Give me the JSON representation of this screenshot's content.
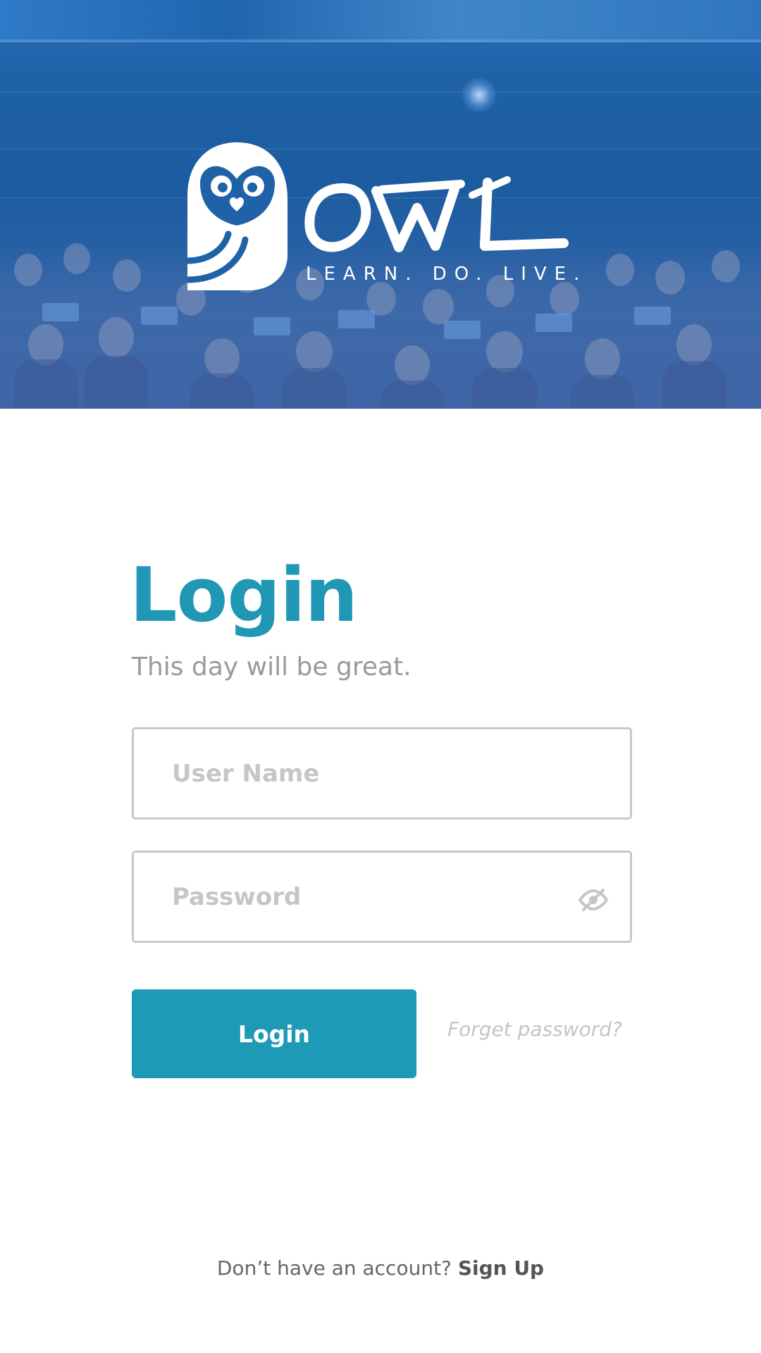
{
  "brand": {
    "name": "OWL",
    "tagline": "LEARN. DO. LIVE."
  },
  "login": {
    "title": "Login",
    "subtitle": "This day will be great.",
    "username_placeholder": "User Name",
    "username_value": "",
    "password_placeholder": "Password",
    "password_value": "",
    "password_toggle_icon": "eye-slash-icon",
    "submit_label": "Login",
    "forgot_label": "Forget password?"
  },
  "footer": {
    "prompt": "Don’t have an account?",
    "signup_label": "Sign Up"
  },
  "colors": {
    "accent": "#1e99b6",
    "hero_blue": "#1f62a8",
    "placeholder": "#c6c6c6",
    "muted_text": "#9a9a9a"
  }
}
